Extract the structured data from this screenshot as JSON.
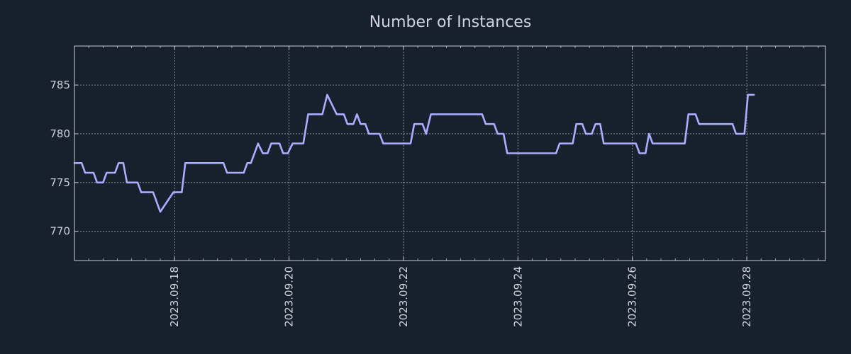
{
  "colors": {
    "background": "#17202d",
    "axes": "#c8ccd2",
    "grid": "#c8ccd2",
    "text": "#cfd3d9",
    "line": "#a9aeff"
  },
  "chart_data": {
    "type": "line",
    "title": "Number of Instances",
    "xlabel": "",
    "ylabel": "",
    "grid": true,
    "x_axis": "date",
    "xlim": [
      "2023-09-16T06:00",
      "2023-09-29T09:00"
    ],
    "ylim": [
      767,
      789
    ],
    "x_ticks": [
      "2023.09.18",
      "2023.09.20",
      "2023.09.22",
      "2023.09.24",
      "2023.09.26",
      "2023.09.28"
    ],
    "x_tick_dates": [
      "2023-09-18",
      "2023-09-20",
      "2023-09-22",
      "2023-09-24",
      "2023-09-26",
      "2023-09-28"
    ],
    "y_ticks": [
      770,
      775,
      780,
      785
    ],
    "series": [
      {
        "name": "",
        "points": [
          [
            "2023-09-16T06:00",
            777
          ],
          [
            "2023-09-16T09:00",
            777
          ],
          [
            "2023-09-16T10:30",
            776
          ],
          [
            "2023-09-16T14:00",
            776
          ],
          [
            "2023-09-16T15:30",
            775
          ],
          [
            "2023-09-16T18:00",
            775
          ],
          [
            "2023-09-16T19:30",
            776
          ],
          [
            "2023-09-16T23:00",
            776
          ],
          [
            "2023-09-17T00:30",
            777
          ],
          [
            "2023-09-17T02:30",
            777
          ],
          [
            "2023-09-17T04:00",
            775
          ],
          [
            "2023-09-17T08:30",
            775
          ],
          [
            "2023-09-17T10:00",
            774
          ],
          [
            "2023-09-17T15:00",
            774
          ],
          [
            "2023-09-17T18:00",
            772
          ],
          [
            "2023-09-17T23:30",
            774
          ],
          [
            "2023-09-18T03:00",
            774
          ],
          [
            "2023-09-18T04:30",
            777
          ],
          [
            "2023-09-18T20:30",
            777
          ],
          [
            "2023-09-18T22:00",
            776
          ],
          [
            "2023-09-19T05:00",
            776
          ],
          [
            "2023-09-19T06:30",
            777
          ],
          [
            "2023-09-19T08:00",
            777
          ],
          [
            "2023-09-19T11:00",
            779
          ],
          [
            "2023-09-19T13:00",
            778
          ],
          [
            "2023-09-19T15:00",
            778
          ],
          [
            "2023-09-19T16:30",
            779
          ],
          [
            "2023-09-19T20:00",
            779
          ],
          [
            "2023-09-19T21:30",
            778
          ],
          [
            "2023-09-19T23:30",
            778
          ],
          [
            "2023-09-20T01:30",
            779
          ],
          [
            "2023-09-20T06:00",
            779
          ],
          [
            "2023-09-20T08:00",
            782
          ],
          [
            "2023-09-20T14:00",
            782
          ],
          [
            "2023-09-20T16:00",
            784
          ],
          [
            "2023-09-20T20:00",
            782
          ],
          [
            "2023-09-20T23:00",
            782
          ],
          [
            "2023-09-21T00:30",
            781
          ],
          [
            "2023-09-21T03:00",
            781
          ],
          [
            "2023-09-21T04:30",
            782
          ],
          [
            "2023-09-21T06:00",
            781
          ],
          [
            "2023-09-21T08:00",
            781
          ],
          [
            "2023-09-21T09:30",
            780
          ],
          [
            "2023-09-21T14:00",
            780
          ],
          [
            "2023-09-21T15:30",
            779
          ],
          [
            "2023-09-22T03:00",
            779
          ],
          [
            "2023-09-22T04:30",
            781
          ],
          [
            "2023-09-22T08:00",
            781
          ],
          [
            "2023-09-22T09:30",
            780
          ],
          [
            "2023-09-22T11:30",
            782
          ],
          [
            "2023-09-23T09:00",
            782
          ],
          [
            "2023-09-23T10:30",
            781
          ],
          [
            "2023-09-23T14:00",
            781
          ],
          [
            "2023-09-23T15:30",
            780
          ],
          [
            "2023-09-23T18:00",
            780
          ],
          [
            "2023-09-23T19:30",
            778
          ],
          [
            "2023-09-24T16:00",
            778
          ],
          [
            "2023-09-24T17:30",
            779
          ],
          [
            "2023-09-24T23:00",
            779
          ],
          [
            "2023-09-25T00:30",
            781
          ],
          [
            "2023-09-25T03:00",
            781
          ],
          [
            "2023-09-25T04:30",
            780
          ],
          [
            "2023-09-25T07:00",
            780
          ],
          [
            "2023-09-25T08:30",
            781
          ],
          [
            "2023-09-25T10:30",
            781
          ],
          [
            "2023-09-25T12:00",
            779
          ],
          [
            "2023-09-26T01:30",
            779
          ],
          [
            "2023-09-26T03:00",
            778
          ],
          [
            "2023-09-26T05:30",
            778
          ],
          [
            "2023-09-26T07:00",
            780
          ],
          [
            "2023-09-26T08:30",
            779
          ],
          [
            "2023-09-26T22:00",
            779
          ],
          [
            "2023-09-26T23:30",
            782
          ],
          [
            "2023-09-27T02:30",
            782
          ],
          [
            "2023-09-27T04:00",
            781
          ],
          [
            "2023-09-27T18:00",
            781
          ],
          [
            "2023-09-27T19:30",
            780
          ],
          [
            "2023-09-27T23:00",
            780
          ],
          [
            "2023-09-28T00:30",
            784
          ],
          [
            "2023-09-28T03:00",
            784
          ]
        ]
      }
    ]
  }
}
